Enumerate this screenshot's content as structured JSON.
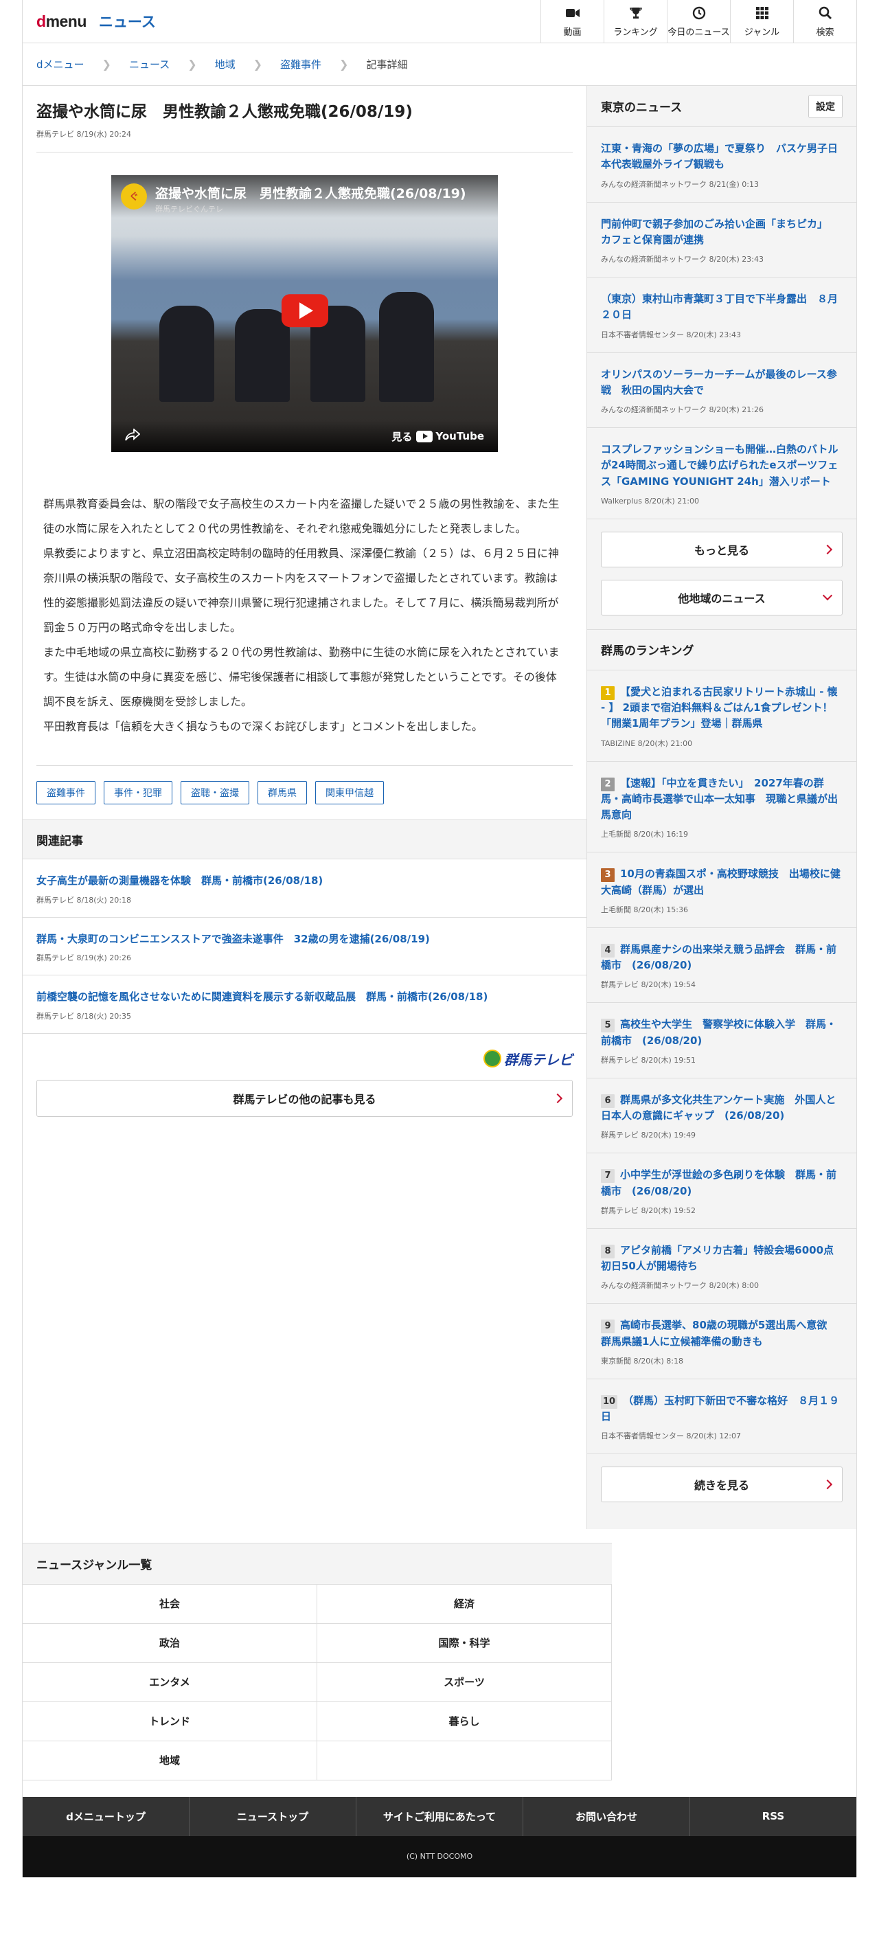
{
  "header": {
    "logo_d": "d",
    "logo_rest": "menu",
    "section": "ニュース",
    "nav": [
      {
        "label": "動画",
        "icon": "video-camera-icon"
      },
      {
        "label": "ランキング",
        "icon": "trophy-icon"
      },
      {
        "label": "今日のニュース",
        "icon": "clock-icon"
      },
      {
        "label": "ジャンル",
        "icon": "grid-icon"
      },
      {
        "label": "検索",
        "icon": "search-icon"
      }
    ]
  },
  "breadcrumb": [
    "dメニュー",
    "ニュース",
    "地域",
    "盗難事件",
    "記事詳細"
  ],
  "article": {
    "title": "盗撮や水筒に尿　男性教諭２人懲戒免職(26/08/19)",
    "meta": "群馬テレビ  8/19(水)  20:24",
    "video_title": "盗撮や水筒に尿　男性教諭２人懲戒免職(26/08/19)",
    "video_channel": "群馬テレビぐんテレ",
    "video_watch": "見る",
    "video_brand": "YouTube",
    "paragraphs": [
      "群馬県教育委員会は、駅の階段で女子高校生のスカート内を盗撮した疑いで２５歳の男性教諭を、また生徒の水筒に尿を入れたとして２０代の男性教諭を、それぞれ懲戒免職処分にしたと発表しました。",
      "県教委によりますと、県立沼田高校定時制の臨時的任用教員、深澤優仁教諭（２５）は、６月２５日に神奈川県の横浜駅の階段で、女子高校生のスカート内をスマートフォンで盗撮したとされています。教諭は性的姿態撮影処罰法違反の疑いで神奈川県警に現行犯逮捕されました。そして７月に、横浜簡易裁判所が罰金５０万円の略式命令を出しました。",
      "また中毛地域の県立高校に勤務する２０代の男性教諭は、勤務中に生徒の水筒に尿を入れたとされています。生徒は水筒の中身に異変を感じ、帰宅後保護者に相談して事態が発覚したということです。その後体調不良を訴え、医療機関を受診しました。",
      "平田教育長は「信頼を大きく損なうもので深くお詫びします」とコメントを出しました。"
    ],
    "tags": [
      "盗難事件",
      "事件・犯罪",
      "盗聴・盗撮",
      "群馬県",
      "関東甲信越"
    ]
  },
  "related": {
    "title": "関連記事",
    "items": [
      {
        "title": "女子高生が最新の測量機器を体験　群馬・前橋市(26/08/18)",
        "meta": "群馬テレビ  8/18(火)  20:18"
      },
      {
        "title": "群馬・大泉町のコンビニエンスストアで強盗未遂事件　32歳の男を逮捕(26/08/19)",
        "meta": "群馬テレビ  8/19(水)  20:26"
      },
      {
        "title": "前橋空襲の記憶を風化させないために関連資料を展示する新収蔵品展　群馬・前橋市(26/08/18)",
        "meta": "群馬テレビ  8/18(火)  20:35"
      }
    ],
    "source_logo": "群馬テレビ",
    "more_label": "群馬テレビの他の記事も見る"
  },
  "side_news": {
    "title": "東京のニュース",
    "setting": "設定",
    "items": [
      {
        "title": "江東・青海の「夢の広場」で夏祭り　バスケ男子日本代表戦屋外ライブ観戦も",
        "meta": "みんなの経済新聞ネットワーク  8/21(金)  0:13"
      },
      {
        "title": "門前仲町で親子参加のごみ拾い企画「まちピカ」　カフェと保育園が連携",
        "meta": "みんなの経済新聞ネットワーク  8/20(木)  23:43"
      },
      {
        "title": "（東京）東村山市青葉町３丁目で下半身露出　８月２０日",
        "meta": "日本不審者情報センター  8/20(木)  23:43"
      },
      {
        "title": "オリンパスのソーラーカーチームが最後のレース参戦　秋田の国内大会で",
        "meta": "みんなの経済新聞ネットワーク  8/20(木)  21:26"
      },
      {
        "title": "コスプレファッションショーも開催…白熱のバトルが24時間ぶっ通しで繰り広げられたeスポーツフェス「GAMING YOUNIGHT 24h」潜入リポート",
        "meta": "Walkerplus  8/20(木)  21:00"
      }
    ],
    "more": "もっと見る",
    "other_region": "他地域のニュース"
  },
  "ranking": {
    "title": "群馬のランキング",
    "items": [
      {
        "rank": "1",
        "title": "【愛犬と泊まれる古民家リトリート赤城山 - 懐 - 】 2頭まで宿泊料無料＆ごはん1食プレゼント！「開業1周年プラン」登場｜群馬県",
        "meta": "TABIZINE  8/20(木)  21:00"
      },
      {
        "rank": "2",
        "title": "【速報】「中立を貫きたい」　2027年春の群馬・高崎市長選挙で山本一太知事　現職と県議が出馬意向",
        "meta": "上毛新聞  8/20(木)  16:19"
      },
      {
        "rank": "3",
        "title": "10月の青森国スポ・高校野球競技　出場校に健大高崎（群馬）が選出",
        "meta": "上毛新聞  8/20(木)  15:36"
      },
      {
        "rank": "4",
        "title": "群馬県産ナシの出来栄え競う品評会　群馬・前橋市　(26/08/20)",
        "meta": "群馬テレビ  8/20(木)  19:54"
      },
      {
        "rank": "5",
        "title": "高校生や大学生　警察学校に体験入学　群馬・前橋市　(26/08/20)",
        "meta": "群馬テレビ  8/20(木)  19:51"
      },
      {
        "rank": "6",
        "title": "群馬県が多文化共生アンケート実施　外国人と日本人の意識にギャップ　(26/08/20)",
        "meta": "群馬テレビ  8/20(木)  19:49"
      },
      {
        "rank": "7",
        "title": "小中学生が浮世絵の多色刷りを体験　群馬・前橋市　(26/08/20)",
        "meta": "群馬テレビ  8/20(木)  19:52"
      },
      {
        "rank": "8",
        "title": "アピタ前橋「アメリカ古着」特設会場6000点　初日50人が開場待ち",
        "meta": "みんなの経済新聞ネットワーク  8/20(木)  8:00"
      },
      {
        "rank": "9",
        "title": "高崎市長選挙、80歳の現職が5選出馬へ意欲　群馬県議1人に立候補準備の動きも",
        "meta": "東京新聞  8/20(木)  8:18"
      },
      {
        "rank": "10",
        "title": "（群馬）玉村町下新田で不審な格好　８月１９日",
        "meta": "日本不審者情報センター  8/20(木)  12:07"
      }
    ],
    "more": "続きを見る"
  },
  "genres": {
    "title": "ニュースジャンル一覧",
    "items": [
      "社会",
      "経済",
      "政治",
      "国際・科学",
      "エンタメ",
      "スポーツ",
      "トレンド",
      "暮らし",
      "地域",
      ""
    ]
  },
  "footer": {
    "nav": [
      "dメニュートップ",
      "ニューストップ",
      "サイトご利用にあたって",
      "お問い合わせ",
      "RSS"
    ],
    "copyright": "(C) NTT DOCOMO"
  },
  "colors": {
    "link": "#1a64b4",
    "brand_red": "#cc0033",
    "gold": "#e6b800",
    "bronze": "#b8642c"
  }
}
